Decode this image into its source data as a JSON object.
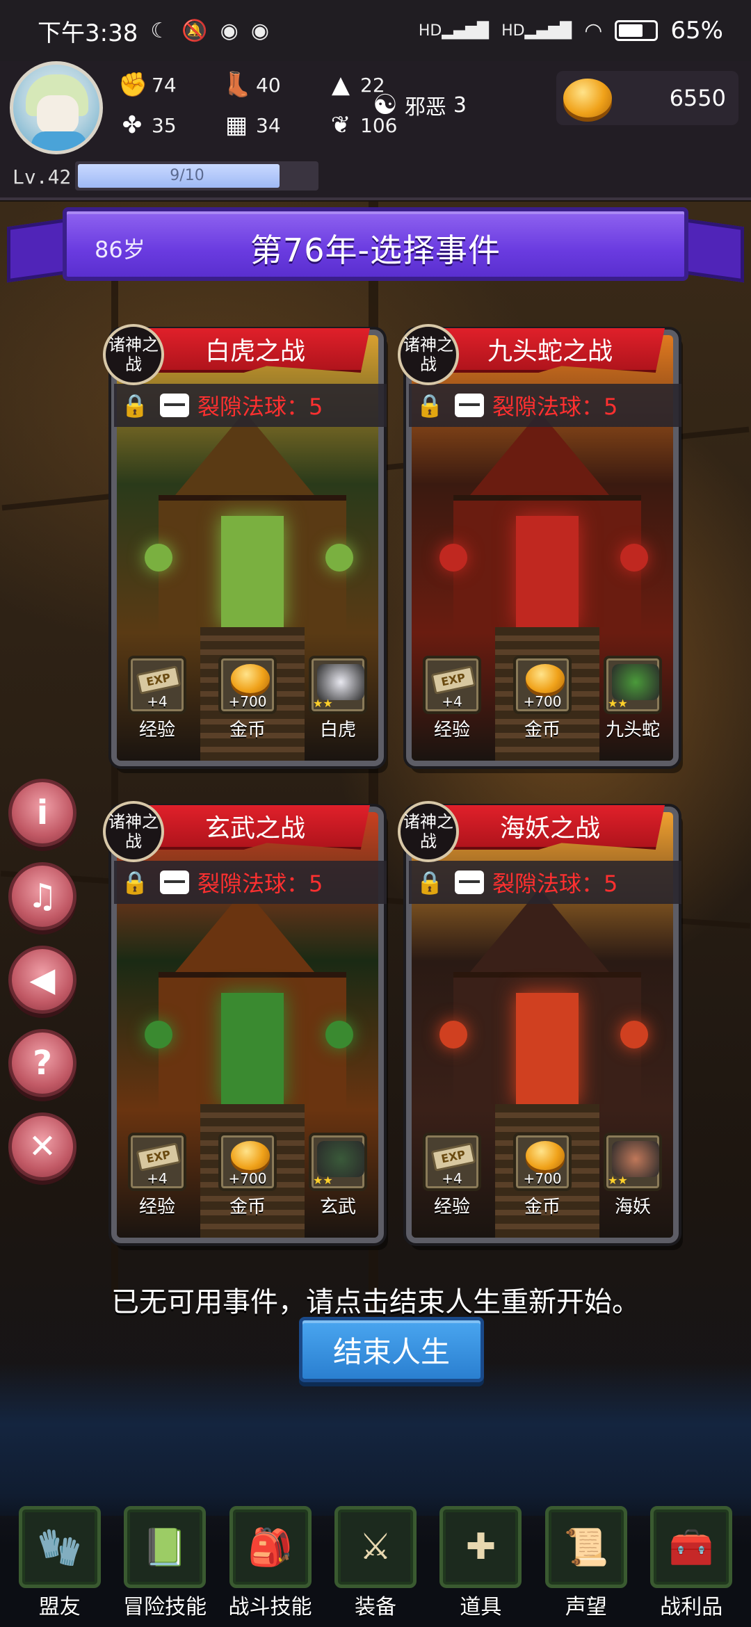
{
  "status_bar": {
    "time": "下午3:38",
    "battery": "65%",
    "signal_labels": [
      "HD",
      "HD"
    ]
  },
  "player": {
    "stats": [
      {
        "icon": "fist-icon",
        "value": "74"
      },
      {
        "icon": "boot-icon",
        "value": "40"
      },
      {
        "icon": "wizard-hat-icon",
        "value": "22"
      },
      {
        "icon": "clover-icon",
        "value": "35"
      },
      {
        "icon": "book-icon",
        "value": "34"
      },
      {
        "icon": "leaf-icon",
        "value": "106"
      }
    ],
    "alignment_label": "邪恶",
    "alignment_value": "3",
    "gold": "6550",
    "level_label": "Lv.42",
    "xp_text": "9/10",
    "xp_fraction": 0.9
  },
  "banner": {
    "age": "86岁",
    "title": "第76年-选择事件"
  },
  "cards": [
    {
      "tag": "诸神之战",
      "name": "白虎之战",
      "orb_text": "裂隙法球：5",
      "rewards": [
        {
          "type": "exp",
          "amount": "+4",
          "label": "经验"
        },
        {
          "type": "gold",
          "amount": "+700",
          "label": "金币"
        },
        {
          "type": "beast",
          "amount": "",
          "label": "白虎"
        }
      ]
    },
    {
      "tag": "诸神之战",
      "name": "九头蛇之战",
      "orb_text": "裂隙法球：5",
      "rewards": [
        {
          "type": "exp",
          "amount": "+4",
          "label": "经验"
        },
        {
          "type": "gold",
          "amount": "+700",
          "label": "金币"
        },
        {
          "type": "beast",
          "amount": "",
          "label": "九头蛇"
        }
      ]
    },
    {
      "tag": "诸神之战",
      "name": "玄武之战",
      "orb_text": "裂隙法球：5",
      "rewards": [
        {
          "type": "exp",
          "amount": "+4",
          "label": "经验"
        },
        {
          "type": "gold",
          "amount": "+700",
          "label": "金币"
        },
        {
          "type": "beast",
          "amount": "",
          "label": "玄武"
        }
      ]
    },
    {
      "tag": "诸神之战",
      "name": "海妖之战",
      "orb_text": "裂隙法球：5",
      "rewards": [
        {
          "type": "exp",
          "amount": "+4",
          "label": "经验"
        },
        {
          "type": "gold",
          "amount": "+700",
          "label": "金币"
        },
        {
          "type": "beast",
          "amount": "",
          "label": "海妖"
        }
      ]
    }
  ],
  "side_buttons": [
    "info-icon",
    "music-icon",
    "speaker-icon",
    "help-icon",
    "close-icon"
  ],
  "message": "已无可用事件，请点击结束人生重新开始。",
  "end_button": "结束人生",
  "nav": [
    {
      "label": "盟友",
      "icon": "gloves-icon"
    },
    {
      "label": "冒险技能",
      "icon": "spellbook-icon"
    },
    {
      "label": "战斗技能",
      "icon": "backpack-icon"
    },
    {
      "label": "装备",
      "icon": "crossed-swords-icon"
    },
    {
      "label": "道具",
      "icon": "satchel-icon"
    },
    {
      "label": "声望",
      "icon": "scroll-icon"
    },
    {
      "label": "战利品",
      "icon": "treasure-chest-icon"
    }
  ],
  "colors": {
    "banner": "#6a3be0",
    "ribbon": "#d01c24",
    "orb_text": "#ff3030",
    "end_button": "#2a7fd0",
    "side_button": "#c25a66"
  }
}
